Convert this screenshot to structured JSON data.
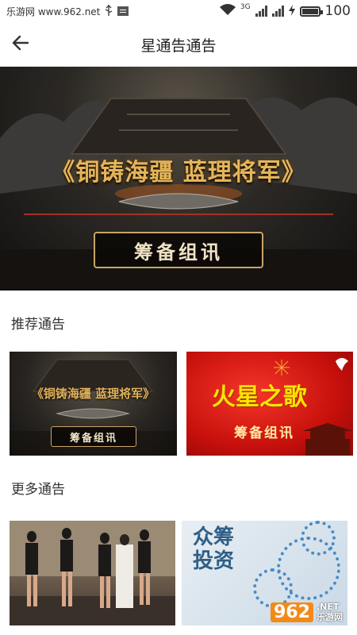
{
  "status_bar": {
    "carrier_text": "乐游网 www.962.net",
    "network_label": "3G",
    "battery": "100",
    "icons": [
      "usb-icon",
      "news-icon",
      "wifi-icon",
      "signal-icon",
      "charging-icon",
      "battery-icon"
    ]
  },
  "header": {
    "title": "星通告通告",
    "back_icon": "arrow-left-icon"
  },
  "banner": {
    "title": "《铜铸海疆 蓝理将军》",
    "subtitle": "筹备组讯"
  },
  "sections": {
    "recommended": {
      "title": "推荐通告",
      "cards": [
        {
          "title": "《铜铸海疆 蓝理将军》",
          "subtitle": "筹备组讯"
        },
        {
          "title": "火星之歌",
          "subtitle": "筹备组讯"
        }
      ]
    },
    "more": {
      "title": "更多通告",
      "cards": [
        {
          "image": "group-photo"
        },
        {
          "text_1": "众筹",
          "text_2": "投资"
        }
      ]
    }
  },
  "watermark": {
    "number": "962",
    "label_1": ".NET",
    "label_2": "乐游网"
  }
}
